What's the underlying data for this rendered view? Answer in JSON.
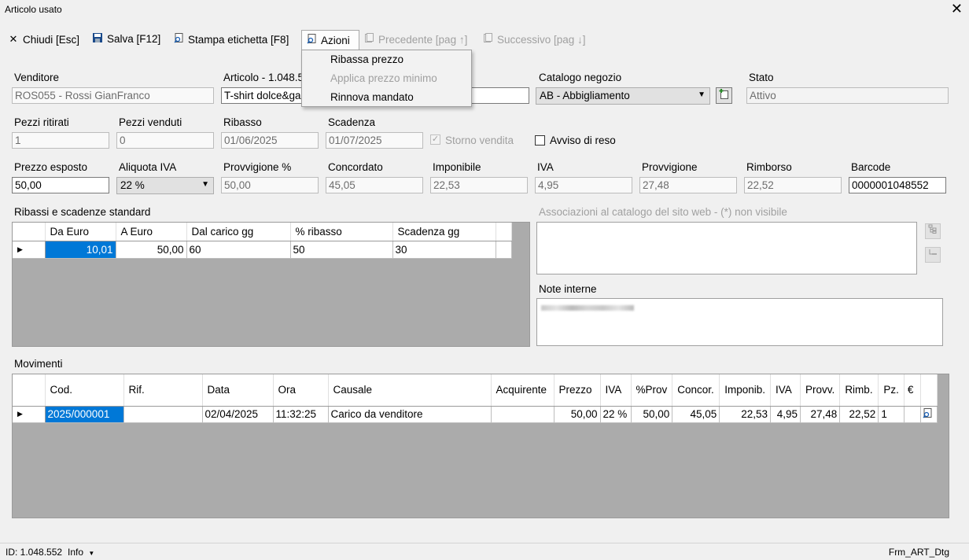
{
  "window": {
    "title": "Articolo usato"
  },
  "toolbar": {
    "close_label": "Chiudi [Esc]",
    "save_label": "Salva [F12]",
    "print_label": "Stampa etichetta [F8]",
    "actions_label": "Azioni",
    "prev_label": "Precedente [pag ↑]",
    "next_label": "Successivo [pag ↓]"
  },
  "menu": {
    "items": [
      "Ribassa prezzo",
      "Applica prezzo minimo",
      "Rinnova mandato"
    ]
  },
  "form": {
    "venditore_label": "Venditore",
    "venditore_value": "ROS055 - Rossi GianFranco",
    "articolo_label": "Articolo - 1.048.55",
    "articolo_value": "T-shirt dolce&ga",
    "catalogo_label": "Catalogo negozio",
    "catalogo_value": "AB - Abbigliamento",
    "stato_label": "Stato",
    "stato_value": "Attivo",
    "pezzi_ritirati_label": "Pezzi ritirati",
    "pezzi_ritirati_value": "1",
    "pezzi_venduti_label": "Pezzi venduti",
    "pezzi_venduti_value": "0",
    "ribasso_label": "Ribasso",
    "ribasso_value": "01/06/2025",
    "scadenza_label": "Scadenza",
    "scadenza_value": "01/07/2025",
    "storno_label": "Storno vendita",
    "avviso_label": "Avviso di reso",
    "prezzo_label": "Prezzo esposto",
    "prezzo_value": "50,00",
    "aliquota_label": "Aliquota IVA",
    "aliquota_value": "22 %",
    "provv_perc_label": "Provvigione %",
    "provv_perc_value": "50,00",
    "concordato_label": "Concordato",
    "concordato_value": "45,05",
    "imponibile_label": "Imponibile",
    "imponibile_value": "22,53",
    "iva_label": "IVA",
    "iva_value": "4,95",
    "provvigione_label": "Provvigione",
    "provvigione_value": "27,48",
    "rimborso_label": "Rimborso",
    "rimborso_value": "22,52",
    "barcode_label": "Barcode",
    "barcode_value": "0000001048552"
  },
  "ribassi": {
    "title": "Ribassi e scadenze standard",
    "columns": [
      "Da Euro",
      "A Euro",
      "Dal carico gg",
      "% ribasso",
      "Scadenza gg"
    ],
    "rows": [
      [
        "10,01",
        "50,00",
        "60",
        "50",
        "30"
      ]
    ]
  },
  "associazioni": {
    "title": "Associazioni al catalogo del sito web - (*) non visibile"
  },
  "note": {
    "title": "Note interne"
  },
  "movimenti": {
    "title": "Movimenti",
    "columns": [
      "Cod.",
      "Rif.",
      "Data",
      "Ora",
      "Causale",
      "Acquirente",
      "Prezzo",
      "IVA",
      "%Prov",
      "Concor.",
      "Imponib.",
      "IVA",
      "Provv.",
      "Rimb.",
      "Pz.",
      "€"
    ],
    "rows": [
      [
        "2025/000001",
        "",
        "02/04/2025",
        "11:32:25",
        "Carico da venditore",
        "",
        "50,00",
        "22 %",
        "50,00",
        "45,05",
        "22,53",
        "4,95",
        "27,48",
        "22,52",
        "1",
        ""
      ]
    ]
  },
  "status": {
    "id_text": "ID: 1.048.552",
    "info_label": "Info",
    "form_name": "Frm_ART_Dtg"
  }
}
